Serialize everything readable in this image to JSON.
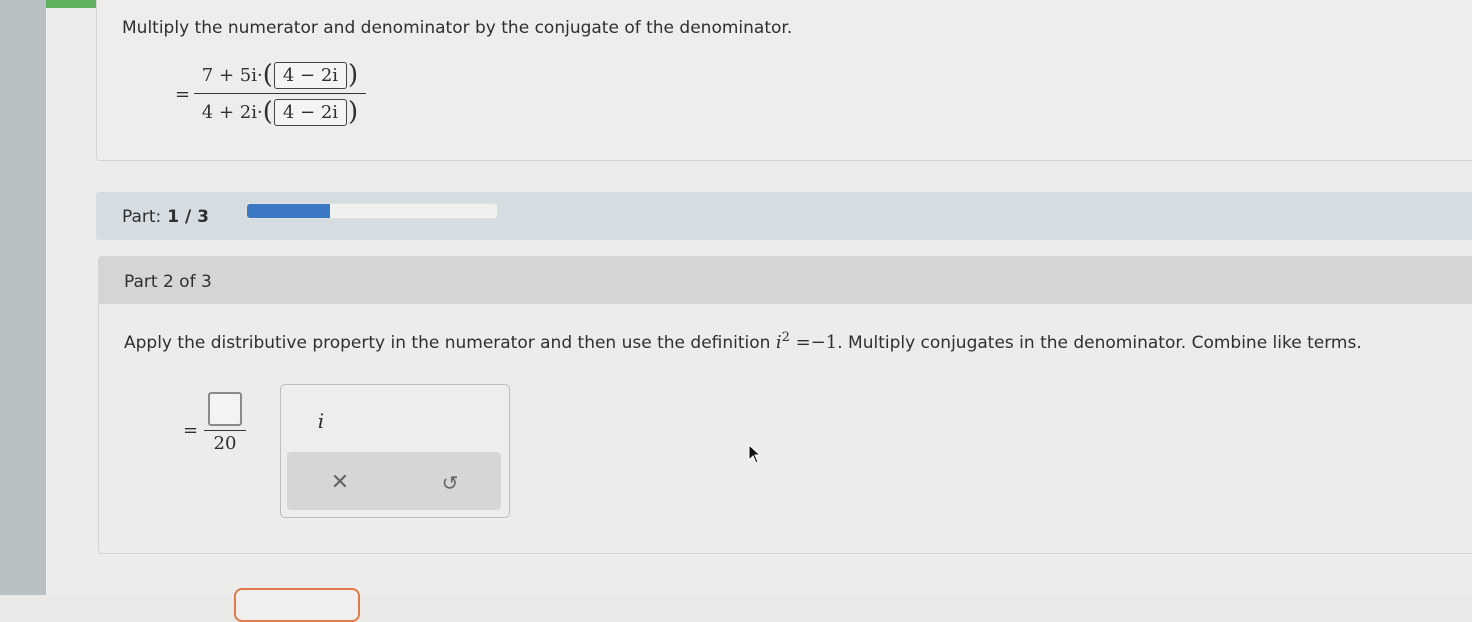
{
  "step": {
    "instruction": "Multiply the numerator and denominator by the conjugate of the denominator.",
    "equals": "=",
    "numerator_expr": "7 + 5i·",
    "numerator_box": "4 − 2i",
    "denominator_expr": "4 + 2i·",
    "denominator_box": "4 − 2i",
    "paren_open": "(",
    "paren_close": ")"
  },
  "progress": {
    "label": "Part:",
    "value": "1 / 3",
    "fraction": 0.33,
    "fill_color": "#3a78c4"
  },
  "part": {
    "title": "Part 2 of 3",
    "instruction_pre": "Apply the distributive property in the numerator and then use the definition ",
    "instruction_math_base": "i",
    "instruction_math_exp": "2",
    "instruction_math_rest": " =−1",
    "instruction_post": ". Multiply conjugates in the denominator. Combine like terms.",
    "equals": "=",
    "denominator": "20"
  },
  "palette": {
    "imaginary_key": "i",
    "clear_icon": "close-icon",
    "undo_icon": "undo-icon",
    "clear_symbol": "✕",
    "undo_symbol": "↺"
  },
  "colors": {
    "top_accent": "#5fb160",
    "bottom_button_border": "#e07a4c"
  }
}
